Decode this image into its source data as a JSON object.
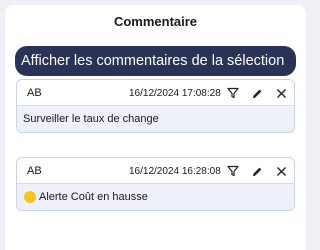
{
  "panel": {
    "title": "Commentaire",
    "show_selection_button": "Afficher les commentaires de la sélection"
  },
  "comments": [
    {
      "author": "AB",
      "date": "16/12/2024 17:08:28",
      "text": "Surveiller le taux de change",
      "indicator": null
    },
    {
      "author": "AB",
      "date": "16/12/2024 16:28:08",
      "text": "Alerte Coût en hausse",
      "indicator": {
        "color": "#f5c518"
      }
    }
  ],
  "icons": {
    "filter": "filter-icon",
    "edit": "pencil-icon",
    "delete": "close-icon"
  }
}
